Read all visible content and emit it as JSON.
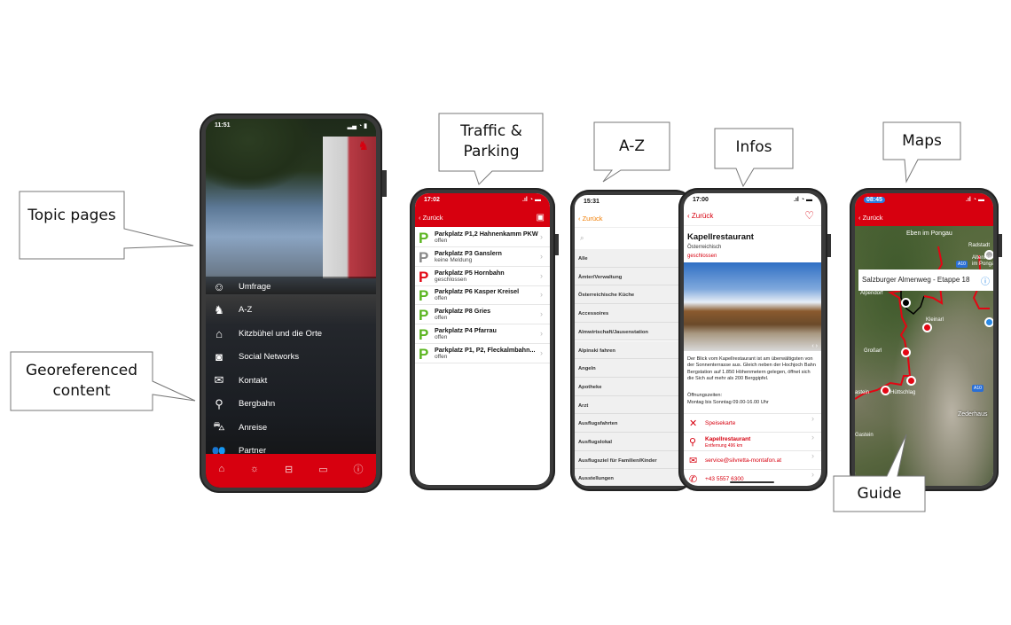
{
  "callouts": {
    "topic": "Topic pages",
    "geo": "Georeferenced content",
    "traffic": "Traffic & Parking",
    "az": "A-Z",
    "infos": "Infos",
    "maps": "Maps",
    "guide": "Guide"
  },
  "colors": {
    "brand_red": "#d7000f",
    "open_green": "#5bb520",
    "unknown_grey": "#888888",
    "closed_red": "#e30613",
    "accent_orange": "#f07c00"
  },
  "phone1": {
    "time": "11:51",
    "menu": [
      {
        "icon": "smiley-icon",
        "glyph": "☺",
        "label": "Umfrage"
      },
      {
        "icon": "chamois-icon",
        "glyph": "♞",
        "label": "A-Z"
      },
      {
        "icon": "town-icon",
        "glyph": "⌂",
        "label": "Kitzbühel und die Orte"
      },
      {
        "icon": "instagram-icon",
        "glyph": "◙",
        "label": "Social Networks"
      },
      {
        "icon": "mail-icon",
        "glyph": "✉",
        "label": "Kontakt"
      },
      {
        "icon": "cable-car-icon",
        "glyph": "⚲",
        "label": "Bergbahn"
      },
      {
        "icon": "car-icon",
        "glyph": "⛍",
        "label": "Anreise"
      },
      {
        "icon": "people-icon",
        "glyph": "👥",
        "label": "Partner"
      }
    ],
    "tabs": [
      {
        "icon": "home-icon",
        "glyph": "⌂"
      },
      {
        "icon": "weather-icon",
        "glyph": "☼"
      },
      {
        "icon": "gondola-icon",
        "glyph": "⊟"
      },
      {
        "icon": "webcam-icon",
        "glyph": "▭"
      },
      {
        "icon": "info-icon",
        "glyph": "ⓘ"
      }
    ]
  },
  "phone2": {
    "time": "17:02",
    "back": "Zurück",
    "rows": [
      {
        "title": "Parkplatz P1,2 Hahnenkamm PKW",
        "status": "offen",
        "state": "open"
      },
      {
        "title": "Parkplatz P3 Ganslern",
        "status": "keine Meldung",
        "state": "unknown"
      },
      {
        "title": "Parkplatz P5 Hornbahn",
        "status": "geschlossen",
        "state": "closed"
      },
      {
        "title": "Parkplatz P6 Kasper Kreisel",
        "status": "offen",
        "state": "open"
      },
      {
        "title": "Parkplatz P8 Gries",
        "status": "offen",
        "state": "open"
      },
      {
        "title": "Parkplatz P4 Pfarrau",
        "status": "offen",
        "state": "open"
      },
      {
        "title": "Parkplatz P1, P2, Fleckalmbahn...",
        "status": "offen",
        "state": "open"
      }
    ]
  },
  "phone3": {
    "time": "15:31",
    "back": "Zurück",
    "categories": [
      "Alle",
      "Ämter/Verwaltung",
      "Österreichische Küche",
      "Accessoires",
      "Almwirtschaft/Jausenstation",
      "Alpinski fahren",
      "Angeln",
      "Apotheke",
      "Arzt",
      "Ausflugsfahrten",
      "Ausflugslokal",
      "Ausflugsziel für Familien/Kinder",
      "Ausstellungen"
    ]
  },
  "phone4": {
    "time": "17:00",
    "back": "Zurück",
    "title": "Kapellrestaurant",
    "cuisine": "Österreichisch",
    "status": "geschlossen",
    "description": "Der Blick vom Kapellrestaurant ist am überwältigsten von der Sonnenterrasse aus. Gleich neben der Hochjoch Bahn Bergstation auf 1.850 Höhenmetern gelegen, öffnet sich die Sich auf mehr als 200 Berggipfel.",
    "hours_label": "Öffnungszeiten:",
    "hours": "Montag bis Sonntag 09.00-16.00 Uhr",
    "menu_label": "Speisekarte",
    "location_name": "Kapellrestaurant",
    "distance": "Entfernung 496 km",
    "email": "service@silvretta-montafon.at",
    "phone": "+43 5557 6300"
  },
  "phone5": {
    "time": "08:45",
    "back": "Zurück",
    "popup": "Salzburger Almenweg - Etappe 18",
    "places": [
      "Eben im Pongau",
      "Radstadt",
      "Altenmarkt im Pongau",
      "Alpendorf",
      "Kleinarl",
      "Großarl",
      "Hüttschlag",
      "Zederhaus",
      "astein",
      "Gastein"
    ],
    "road": "A10"
  }
}
